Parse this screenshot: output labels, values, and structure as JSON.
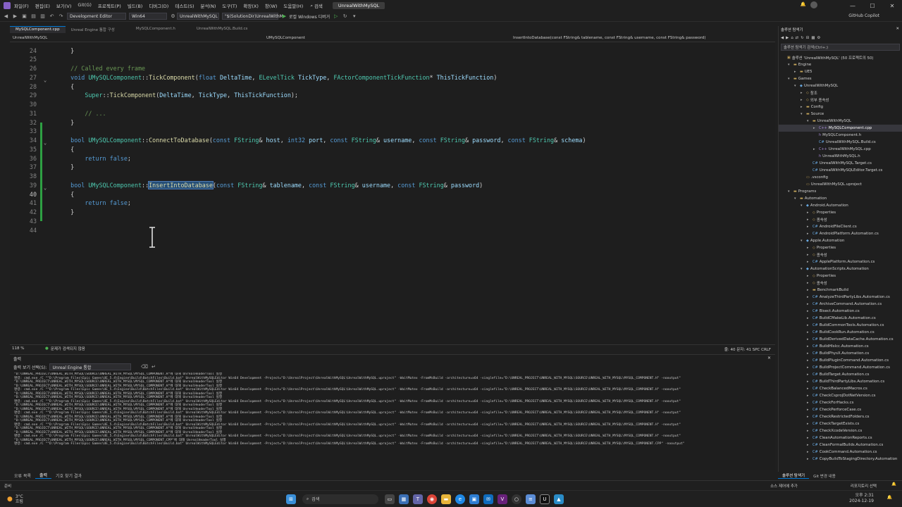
{
  "titlebar": {
    "menu": [
      "파일(F)",
      "편집(E)",
      "보기(V)",
      "Git(G)",
      "프로젝트(P)",
      "빌드(B)",
      "디버그(D)",
      "테스트(S)",
      "분석(N)",
      "도구(T)",
      "확장(X)",
      "창(W)",
      "도움말(H)"
    ],
    "search_label": "검색",
    "project_name": "UnrealWithMySQL",
    "copilot": "GitHub Copilot"
  },
  "toolbar": {
    "config": "Development Editor",
    "platform": "Win64",
    "startup_project": "UnrealWithMySQL",
    "command_args": "\"$(SolutionDir)UnrealWithM",
    "debugger": "로컬 Windows 디버거"
  },
  "tabs": [
    {
      "label": "MySQLComponent.cpp",
      "active": true
    },
    {
      "label": "Unreal Engine 통합 구성",
      "active": false
    },
    {
      "label": "MySQLComponent.h",
      "active": false
    },
    {
      "label": "UnrealWithMySQL.Build.cs",
      "active": false
    }
  ],
  "navbar": {
    "project": "UnrealWithMySQL",
    "scope": "UMySQLComponent",
    "member": "InsertIntoDatabase(const FString& tablename, const FString& username, const FString& password)"
  },
  "editor": {
    "lines": [
      {
        "n": "24",
        "fold": false,
        "chg": false,
        "html": "    }"
      },
      {
        "n": "25",
        "fold": false,
        "chg": false,
        "html": ""
      },
      {
        "n": "26",
        "fold": false,
        "chg": false,
        "html": "    <span class='cm'>// Called every frame</span>"
      },
      {
        "n": "27",
        "fold": true,
        "chg": false,
        "html": "    <span class='kw'>void</span> <span class='ty'>UMySQLComponent</span>::<span class='fn'>TickComponent</span>(<span class='kw'>float</span> <span class='pm'>DeltaTime</span>, <span class='ty'>ELevelTick</span> <span class='pm'>TickType</span>, <span class='ty'>FActorComponentTickFunction</span>* <span class='pm'>ThisTickFunction</span>)"
      },
      {
        "n": "28",
        "fold": false,
        "chg": false,
        "html": "    {"
      },
      {
        "n": "29",
        "fold": false,
        "chg": false,
        "html": "        <span class='ty'>Super</span>::<span class='fn'>TickComponent</span>(<span class='pm'>DeltaTime</span>, <span class='pm'>TickType</span>, <span class='pm'>ThisTickFunction</span>);"
      },
      {
        "n": "30",
        "fold": false,
        "chg": false,
        "html": ""
      },
      {
        "n": "31",
        "fold": false,
        "chg": false,
        "html": "        <span class='cm'>// ...</span>"
      },
      {
        "n": "32",
        "fold": false,
        "chg": true,
        "html": "    }"
      },
      {
        "n": "33",
        "fold": false,
        "chg": true,
        "html": ""
      },
      {
        "n": "34",
        "fold": true,
        "chg": true,
        "html": "    <span class='kw'>bool</span> <span class='ty'>UMySQLComponent</span>::<span class='fn'>ConnectToDatabase</span>(<span class='kw'>const</span> <span class='ty'>FString</span>&amp; <span class='pm'>host</span>, <span class='kw'>int32</span> <span class='pm'>port</span>, <span class='kw'>const</span> <span class='ty'>FString</span>&amp; <span class='pm'>username</span>, <span class='kw'>const</span> <span class='ty'>FString</span>&amp; <span class='pm'>password</span>, <span class='kw'>const</span> <span class='ty'>FString</span>&amp; <span class='pm'>schema</span>)"
      },
      {
        "n": "35",
        "fold": false,
        "chg": true,
        "html": "    {"
      },
      {
        "n": "36",
        "fold": false,
        "chg": true,
        "html": "        <span class='kw'>return</span> <span class='kw'>false</span>;"
      },
      {
        "n": "37",
        "fold": false,
        "chg": true,
        "html": "    }"
      },
      {
        "n": "38",
        "fold": false,
        "chg": true,
        "html": ""
      },
      {
        "n": "39",
        "fold": true,
        "chg": true,
        "html": "    <span class='kw'>bool</span> <span class='ty'>UMySQLComponent</span>::<span class='sel'>InsertIntoDatabase</span>(<span class='kw'>const</span> <span class='ty'>FString</span>&amp; <span class='pm'>tablename</span>, <span class='kw'>const</span> <span class='ty'>FString</span>&amp; <span class='pm'>username</span>, <span class='kw'>const</span> <span class='ty'>FString</span>&amp; <span class='pm'>password</span>)"
      },
      {
        "n": "40",
        "fold": false,
        "chg": true,
        "html": "    {"
      },
      {
        "n": "41",
        "fold": false,
        "chg": true,
        "html": "        <span class='kw'>return</span> <span class='kw'>false</span>;"
      },
      {
        "n": "42",
        "fold": false,
        "chg": true,
        "html": "    }"
      },
      {
        "n": "43",
        "fold": false,
        "chg": false,
        "html": ""
      },
      {
        "n": "44",
        "fold": false,
        "chg": false,
        "html": ""
      }
    ],
    "current_line": "40",
    "status": {
      "zoom": "118 %",
      "issues": "문제가 검색되지 않음",
      "position": "줄: 40  문자: 41  SPC  CRLF"
    }
  },
  "output": {
    "title": "출력",
    "source_label": "출력 보기 선택(S):",
    "source_value": "Unreal Engine 통합",
    "lines": [
      "\"D:\\UNREAL_PROJECT\\UNREAL_WITH_MYSQL\\SOURCE\\UNREAL_WITH_MYSQL\\MYSQL_COMPONENT.H\"에 대해 UnrealHeaderTool 실행",
      "명령: cmd.exe /C \"\"D:\\Program Files\\Epic Games\\UE_5.4\\Engine\\Build\\BatchFiles\\Build.bat\" UnrealWithMySQLEditor Win64 Development -Project=\"D:\\UnrealProject\\UnrealWithMySQL\\UnrealWithMySQL.uproject\" -WaitMutex -FromMsBuild -architecture=x64 -singlefile=\"D:\\UNREAL_PROJECT\\UNREAL_WITH_MYSQL\\SOURCE\\UNREAL_WITH_MYSQL\\MYSQL_COMPONENT.H\" -nooutput\"",
      "\"D:\\UNREAL_PROJECT\\UNREAL_WITH_MYSQL\\SOURCE\\UNREAL_WITH_MYSQL\\MYSQL_COMPONENT.H\"에 대해 UnrealHeaderTool 실행",
      "\"D:\\UNREAL_PROJECT\\UNREAL_WITH_MYSQL\\SOURCE\\UNREAL_WITH_MYSQL\\MYSQL_COMPONENT.H\"에 대해 UnrealHeaderTool 실행",
      "명령: cmd.exe /C \"\"D:\\Program Files\\Epic Games\\UE_5.4\\Engine\\Build\\BatchFiles\\Build.bat\" UnrealWithMySQLEditor Win64 Development -Project=\"D:\\UnrealProject\\UnrealWithMySQL\\UnrealWithMySQL.uproject\" -WaitMutex -FromMsBuild -architecture=x64 -singlefile=\"D:\\UNREAL_PROJECT\\UNREAL_WITH_MYSQL\\SOURCE\\UNREAL_WITH_MYSQL\\MYSQL_COMPONENT.H\" -nooutput\"",
      "\"D:\\UNREAL_PROJECT\\UNREAL_WITH_MYSQL\\SOURCE\\UNREAL_WITH_MYSQL\\MYSQL_COMPONENT.H\"에 대해 UnrealHeaderTool 실행",
      "\"D:\\UNREAL_PROJECT\\UNREAL_WITH_MYSQL\\SOURCE\\UNREAL_WITH_MYSQL\\MYSQL_COMPONENT.H\"에 대해 UnrealHeaderTool 실행",
      "명령: cmd.exe /C \"\"D:\\Program Files\\Epic Games\\UE_5.4\\Engine\\Build\\BatchFiles\\Build.bat\" UnrealWithMySQLEditor Win64 Development -Project=\"D:\\UnrealProject\\UnrealWithMySQL\\UnrealWithMySQL.uproject\" -WaitMutex -FromMsBuild -architecture=x64 -singlefile=\"D:\\UNREAL_PROJECT\\UNREAL_WITH_MYSQL\\SOURCE\\UNREAL_WITH_MYSQL\\MYSQL_COMPONENT.H\" -nooutput\"",
      "\"D:\\UNREAL_PROJECT\\UNREAL_WITH_MYSQL\\SOURCE\\UNREAL_WITH_MYSQL\\MYSQL_COMPONENT.H\"에 대해 UnrealHeaderTool 실행",
      "\"D:\\UNREAL_PROJECT\\UNREAL_WITH_MYSQL\\SOURCE\\UNREAL_WITH_MYSQL\\MYSQL_COMPONENT.H\"에 대해 UnrealHeaderTool 실행",
      "명령: cmd.exe /C \"\"D:\\Program Files\\Epic Games\\UE_5.4\\Engine\\Build\\BatchFiles\\Build.bat\" UnrealWithMySQLEditor Win64 Development -Project=\"D:\\UnrealProject\\UnrealWithMySQL\\UnrealWithMySQL.uproject\" -WaitMutex -FromMsBuild -architecture=x64 -singlefile=\"D:\\UNREAL_PROJECT\\UNREAL_WITH_MYSQL\\SOURCE\\UNREAL_WITH_MYSQL\\MYSQL_COMPONENT.H\" -nooutput\"",
      "\"D:\\UNREAL_PROJECT\\UNREAL_WITH_MYSQL\\SOURCE\\UNREAL_WITH_MYSQL\\MYSQL_COMPONENT.H\"에 대해 UnrealHeaderTool 실행",
      "\"D:\\UNREAL_PROJECT\\UNREAL_WITH_MYSQL\\SOURCE\\UNREAL_WITH_MYSQL\\MYSQL_COMPONENT.H\"에 대해 UnrealHeaderTool 실행",
      "명령: cmd.exe /C \"\"D:\\Program Files\\Epic Games\\UE_5.4\\Engine\\Build\\BatchFiles\\Build.bat\" UnrealWithMySQLEditor Win64 Development -Project=\"D:\\UnrealProject\\UnrealWithMySQL\\UnrealWithMySQL.uproject\" -WaitMutex -FromMsBuild -architecture=x64 -singlefile=\"D:\\UNREAL_PROJECT\\UNREAL_WITH_MYSQL\\SOURCE\\UNREAL_WITH_MYSQL\\MYSQL_COMPONENT.H\" -nooutput\"",
      "\"D:\\UNREAL_PROJECT\\UNREAL_WITH_MYSQL\\SOURCE\\UNREAL_WITH_MYSQL\\MYSQL_COMPONENT.H\"에 대해 UnrealHeaderTool 실행",
      "\"D:\\UNREAL_PROJECT\\UNREAL_WITH_MYSQL\\SOURCE\\UNREAL_WITH_MYSQL\\MYSQL_COMPONENT.H\"에 대해 UnrealHeaderTool 실행",
      "명령: cmd.exe /C \"\"D:\\Program Files\\Epic Games\\UE_5.4\\Engine\\Build\\BatchFiles\\Build.bat\" UnrealWithMySQLEditor Win64 Development -Project=\"D:\\UnrealProject\\UnrealWithMySQL\\UnrealWithMySQL.uproject\" -WaitMutex -FromMsBuild -architecture=x64 -singlefile=\"D:\\UNREAL_PROJECT\\UNREAL_WITH_MYSQL\\SOURCE\\UNREAL_WITH_MYSQL\\MYSQL_COMPONENT.H\" -nooutput\"",
      "\"D:\\UNREAL_PROJECT\\UNREAL_WITH_MYSQL\\SOURCE\\UNREAL_WITH_MYSQL\\MYSQL_COMPONENT.CPP\"에 대해 UnrealHeaderTool 실행",
      "명령: cmd.exe /C \"\"D:\\Program Files\\Epic Games\\UE_5.4\\Engine\\Build\\BatchFiles\\Build.bat\" UnrealWithMySQLEditor Win64 Development -Project=\"D:\\UnrealProject\\UnrealWithMySQL\\UnrealWithMySQL.uproject\" -WaitMutex -FromMsBuild -architecture=x64 -singlefile=\"D:\\UNREAL_PROJECT\\UNREAL_WITH_MYSQL\\SOURCE\\UNREAL_WITH_MYSQL\\MYSQL_COMPONENT.CPP\" -nooutput\""
    ],
    "bottom_tabs": [
      "오류 목록",
      "출력",
      "기호 찾기 결과"
    ]
  },
  "solution": {
    "title": "솔루션 탐색기",
    "search_placeholder": "솔루션 탐색기 검색(Ctrl+;)",
    "items": [
      {
        "d": 0,
        "a": "",
        "i": "sln",
        "t": "솔루션 'UnrealWithMySQL' (50 프로젝트의 50)",
        "sel": false
      },
      {
        "d": 1,
        "a": "▾",
        "i": "folder",
        "t": "Engine",
        "sel": false
      },
      {
        "d": 2,
        "a": "▸",
        "i": "folder",
        "t": "UE5",
        "sel": false
      },
      {
        "d": 1,
        "a": "▾",
        "i": "folder",
        "t": "Games",
        "sel": false
      },
      {
        "d": 2,
        "a": "▾",
        "i": "proj",
        "t": "UnrealWithMySQL",
        "sel": false
      },
      {
        "d": 3,
        "a": "▸",
        "i": "ref",
        "t": "참조",
        "sel": false
      },
      {
        "d": 3,
        "a": "▸",
        "i": "ref",
        "t": "외부 종속성",
        "sel": false
      },
      {
        "d": 3,
        "a": "▸",
        "i": "folder",
        "t": "Config",
        "sel": false
      },
      {
        "d": 3,
        "a": "▾",
        "i": "folder",
        "t": "Source",
        "sel": false
      },
      {
        "d": 4,
        "a": "▾",
        "i": "folder",
        "t": "UnrealWithMySQL",
        "sel": false
      },
      {
        "d": 5,
        "a": "▸",
        "i": "cpp",
        "t": "MySQLComponent.cpp",
        "sel": true
      },
      {
        "d": 5,
        "a": "",
        "i": "h",
        "t": "MySQLComponent.h",
        "sel": false
      },
      {
        "d": 5,
        "a": "",
        "i": "cs",
        "t": "UnrealWithMySQL.Build.cs",
        "sel": false
      },
      {
        "d": 5,
        "a": "▸",
        "i": "cpp",
        "t": "UnrealWithMySQL.cpp",
        "sel": false
      },
      {
        "d": 5,
        "a": "",
        "i": "h",
        "t": "UnrealWithMySQL.h",
        "sel": false
      },
      {
        "d": 4,
        "a": "",
        "i": "cs",
        "t": "UnrealWithMySQL.Target.cs",
        "sel": false
      },
      {
        "d": 4,
        "a": "",
        "i": "cs",
        "t": "UnrealWithMySQLEditor.Target.cs",
        "sel": false
      },
      {
        "d": 3,
        "a": "",
        "i": "file",
        "t": ".vsconfig",
        "sel": false
      },
      {
        "d": 3,
        "a": "",
        "i": "file",
        "t": "UnrealWithMySQL.uproject",
        "sel": false
      },
      {
        "d": 1,
        "a": "▾",
        "i": "folder",
        "t": "Programs",
        "sel": false
      },
      {
        "d": 2,
        "a": "▾",
        "i": "folder",
        "t": "Automation",
        "sel": false
      },
      {
        "d": 3,
        "a": "▾",
        "i": "proj",
        "t": "Android.Automation",
        "sel": false
      },
      {
        "d": 4,
        "a": "▸",
        "i": "ref",
        "t": "Properties",
        "sel": false
      },
      {
        "d": 4,
        "a": "▸",
        "i": "ref",
        "t": "종속성",
        "sel": false
      },
      {
        "d": 4,
        "a": "▸",
        "i": "cs",
        "t": "AndroidFileClient.cs",
        "sel": false
      },
      {
        "d": 4,
        "a": "▸",
        "i": "cs",
        "t": "AndroidPlatform.Automation.cs",
        "sel": false
      },
      {
        "d": 3,
        "a": "▾",
        "i": "proj",
        "t": "Apple.Automation",
        "sel": false
      },
      {
        "d": 4,
        "a": "▸",
        "i": "ref",
        "t": "Properties",
        "sel": false
      },
      {
        "d": 4,
        "a": "▸",
        "i": "ref",
        "t": "종속성",
        "sel": false
      },
      {
        "d": 4,
        "a": "▸",
        "i": "cs",
        "t": "ApplePlatform.Automation.cs",
        "sel": false
      },
      {
        "d": 3,
        "a": "▾",
        "i": "proj",
        "t": "AutomationScripts.Automation",
        "sel": false
      },
      {
        "d": 4,
        "a": "▸",
        "i": "ref",
        "t": "Properties",
        "sel": false
      },
      {
        "d": 4,
        "a": "▸",
        "i": "ref",
        "t": "종속성",
        "sel": false
      },
      {
        "d": 4,
        "a": "▸",
        "i": "folder",
        "t": "BenchmarkBuild",
        "sel": false
      },
      {
        "d": 4,
        "a": "▸",
        "i": "cs",
        "t": "AnalyzeThirdPartyLibs.Automation.cs",
        "sel": false
      },
      {
        "d": 4,
        "a": "▸",
        "i": "cs",
        "t": "ArchiveCommand.Automation.cs",
        "sel": false
      },
      {
        "d": 4,
        "a": "▸",
        "i": "cs",
        "t": "Bisect.Automation.cs",
        "sel": false
      },
      {
        "d": 4,
        "a": "▸",
        "i": "cs",
        "t": "BuildCMakeLib.Automation.cs",
        "sel": false
      },
      {
        "d": 4,
        "a": "▸",
        "i": "cs",
        "t": "BuildCommonTools.Automation.cs",
        "sel": false
      },
      {
        "d": 4,
        "a": "▸",
        "i": "cs",
        "t": "BuildCookRun.Automation.cs",
        "sel": false
      },
      {
        "d": 4,
        "a": "▸",
        "i": "cs",
        "t": "BuildDerivedDataCache.Automation.cs",
        "sel": false
      },
      {
        "d": 4,
        "a": "▸",
        "i": "cs",
        "t": "BuildHlslcc.Automation.cs",
        "sel": false
      },
      {
        "d": 4,
        "a": "▸",
        "i": "cs",
        "t": "BuildPhysX.Automation.cs",
        "sel": false
      },
      {
        "d": 4,
        "a": "▸",
        "i": "cs",
        "t": "BuildPluginCommand.Automation.cs",
        "sel": false
      },
      {
        "d": 4,
        "a": "▸",
        "i": "cs",
        "t": "BuildProjectCommand.Automation.cs",
        "sel": false
      },
      {
        "d": 4,
        "a": "▸",
        "i": "cs",
        "t": "BuildTarget.Automation.cs",
        "sel": false
      },
      {
        "d": 4,
        "a": "▸",
        "i": "cs",
        "t": "BuildThirdPartyLibs.Automation.cs",
        "sel": false
      },
      {
        "d": 4,
        "a": "▸",
        "i": "cs",
        "t": "CheckBalancedMacros.cs",
        "sel": false
      },
      {
        "d": 4,
        "a": "▸",
        "i": "cs",
        "t": "CheckCsprojDotNetVersion.cs",
        "sel": false
      },
      {
        "d": 4,
        "a": "▸",
        "i": "cs",
        "t": "CheckForHacks.cs",
        "sel": false
      },
      {
        "d": 4,
        "a": "▸",
        "i": "cs",
        "t": "CheckPerforceCase.cs",
        "sel": false
      },
      {
        "d": 4,
        "a": "▸",
        "i": "cs",
        "t": "CheckRestrictedFolders.cs",
        "sel": false
      },
      {
        "d": 4,
        "a": "▸",
        "i": "cs",
        "t": "CheckTargetExists.cs",
        "sel": false
      },
      {
        "d": 4,
        "a": "▸",
        "i": "cs",
        "t": "CheckXcodeVersion.cs",
        "sel": false
      },
      {
        "d": 4,
        "a": "▸",
        "i": "cs",
        "t": "CleanAutomationReports.cs",
        "sel": false
      },
      {
        "d": 4,
        "a": "▸",
        "i": "cs",
        "t": "CleanFormalBuilds.Automation.cs",
        "sel": false
      },
      {
        "d": 4,
        "a": "▸",
        "i": "cs",
        "t": "CookCommand.Automation.cs",
        "sel": false
      },
      {
        "d": 4,
        "a": "▸",
        "i": "cs",
        "t": "CopyBuildToStagingDirectory.Automation",
        "sel": false
      }
    ],
    "bottom_tabs": [
      "솔루션 탐색기",
      "Git 변경 내용"
    ]
  },
  "statusbar": {
    "left": "준비",
    "source_control": "소스 제어에 추가",
    "repo": "리포지토리 선택"
  },
  "taskbar": {
    "weather_temp": "3°C",
    "weather_desc": "흐림",
    "search": "검색",
    "time": "오후 2:31",
    "date": "2024-12-19"
  }
}
